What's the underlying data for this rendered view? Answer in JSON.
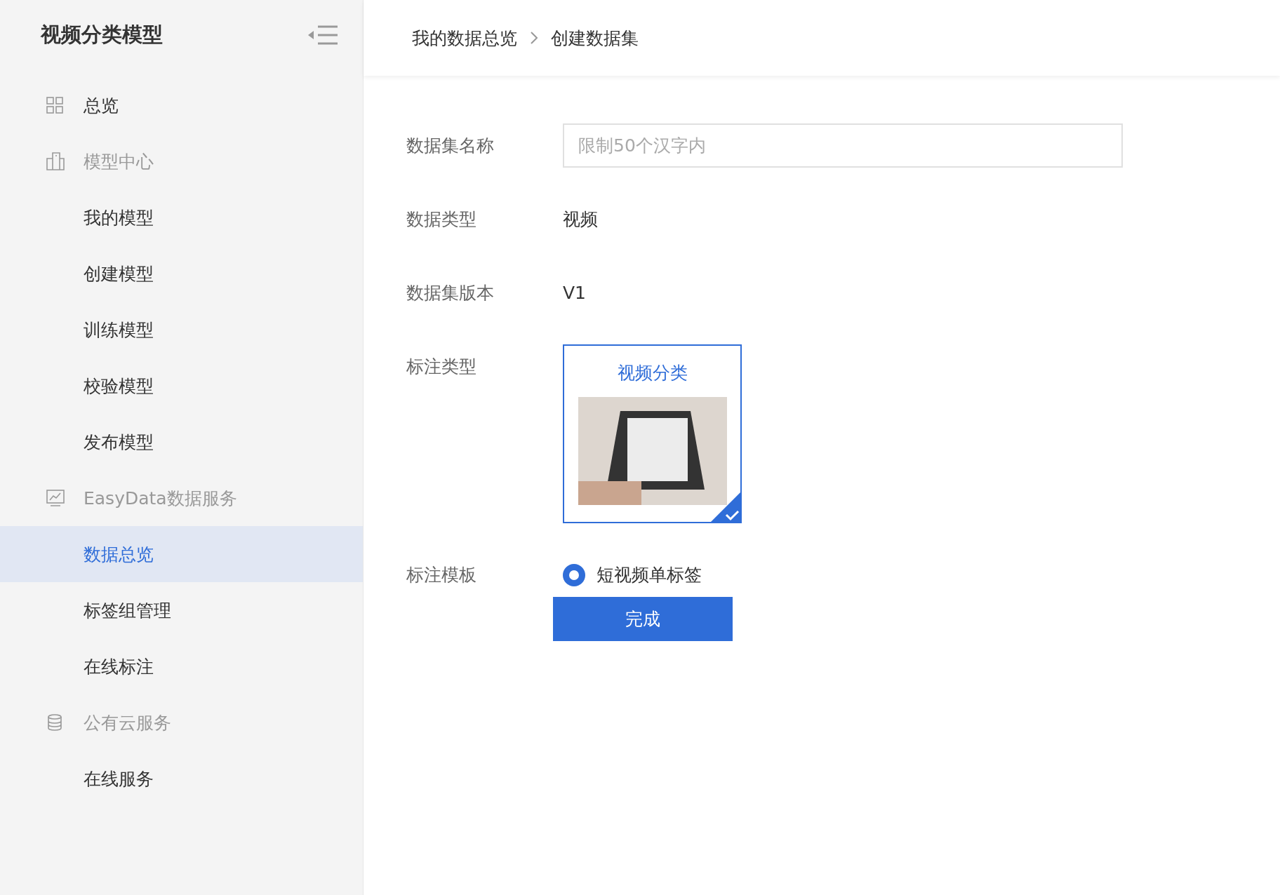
{
  "sidebar": {
    "title": "视频分类模型",
    "items": [
      {
        "kind": "top",
        "label": "总览",
        "selected": false
      },
      {
        "kind": "section",
        "label": "模型中心",
        "selected": false
      },
      {
        "kind": "item",
        "label": "我的模型",
        "selected": false
      },
      {
        "kind": "item",
        "label": "创建模型",
        "selected": false
      },
      {
        "kind": "item",
        "label": "训练模型",
        "selected": false
      },
      {
        "kind": "item",
        "label": "校验模型",
        "selected": false
      },
      {
        "kind": "item",
        "label": "发布模型",
        "selected": false
      },
      {
        "kind": "section",
        "label": "EasyData数据服务",
        "selected": false
      },
      {
        "kind": "item",
        "label": "数据总览",
        "selected": true
      },
      {
        "kind": "item",
        "label": "标签组管理",
        "selected": false
      },
      {
        "kind": "item",
        "label": "在线标注",
        "selected": false
      },
      {
        "kind": "section",
        "label": "公有云服务",
        "selected": false
      },
      {
        "kind": "item",
        "label": "在线服务",
        "selected": false
      }
    ]
  },
  "breadcrumb": [
    "我的数据总览",
    "创建数据集"
  ],
  "form": {
    "name": {
      "label": "数据集名称",
      "placeholder": "限制50个汉字内"
    },
    "data_type": {
      "label": "数据类型",
      "value": "视频"
    },
    "version": {
      "label": "数据集版本",
      "value": "V1"
    },
    "annotation_type": {
      "label": "标注类型",
      "options": [
        {
          "title": "视频分类",
          "selected": true
        }
      ]
    },
    "template": {
      "label": "标注模板",
      "options": [
        {
          "label": "短视频单标签",
          "selected": true
        }
      ]
    },
    "submit": "完成"
  }
}
